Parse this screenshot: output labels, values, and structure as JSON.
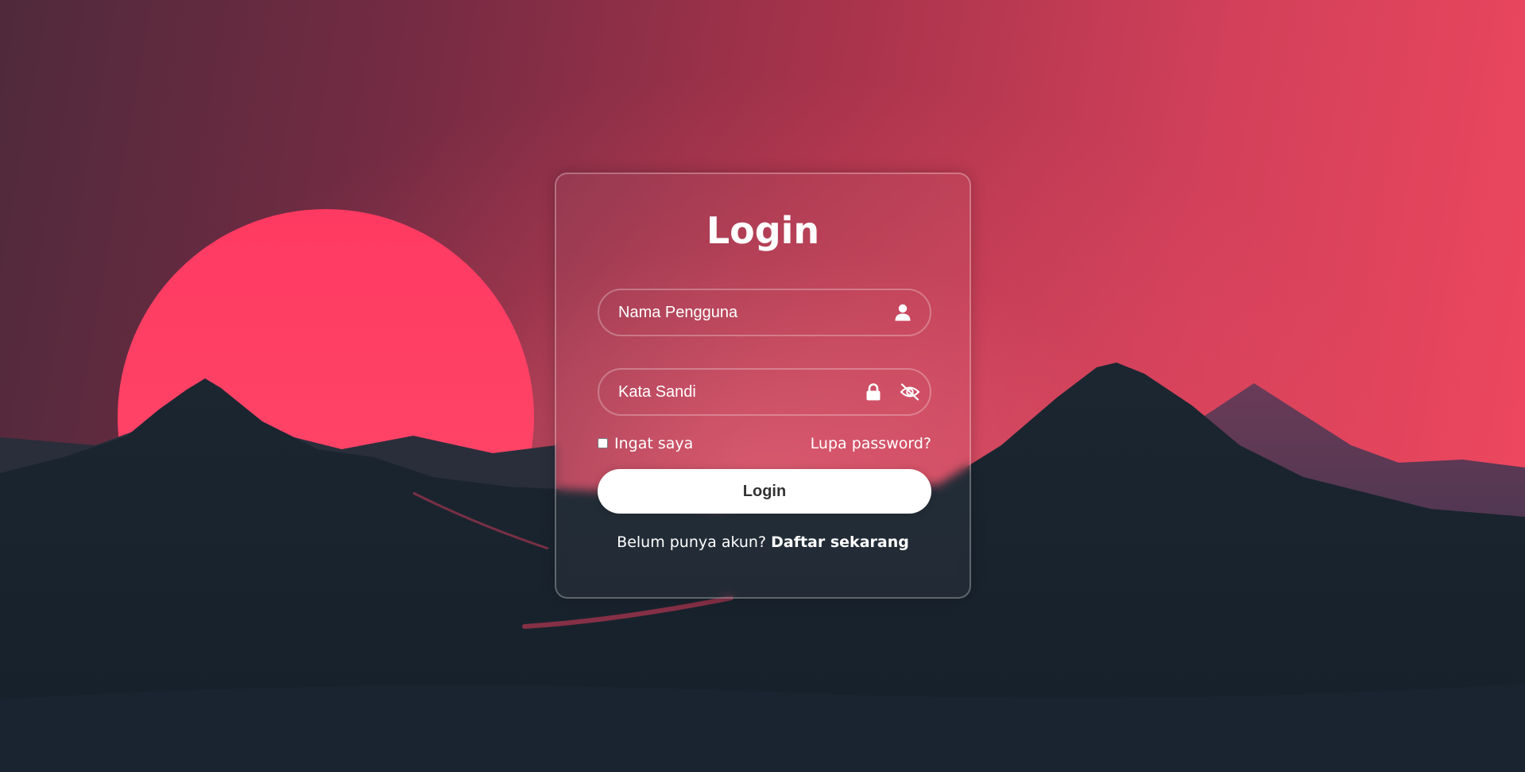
{
  "login": {
    "title": "Login",
    "username_placeholder": "Nama Pengguna",
    "password_placeholder": "Kata Sandi",
    "remember_label": "Ingat saya",
    "forgot_link": "Lupa password?",
    "submit_label": "Login",
    "no_account_text": "Belum punya akun?",
    "register_link": "Daftar sekarang"
  },
  "icons": {
    "username": "user-icon",
    "password": "lock-icon",
    "toggle_password": "eye-slash-icon"
  },
  "colors": {
    "sun": "#ff3b63",
    "mountains": "#1b2530",
    "button_bg": "#ffffff",
    "button_text": "#333333",
    "text": "#ffffff"
  }
}
